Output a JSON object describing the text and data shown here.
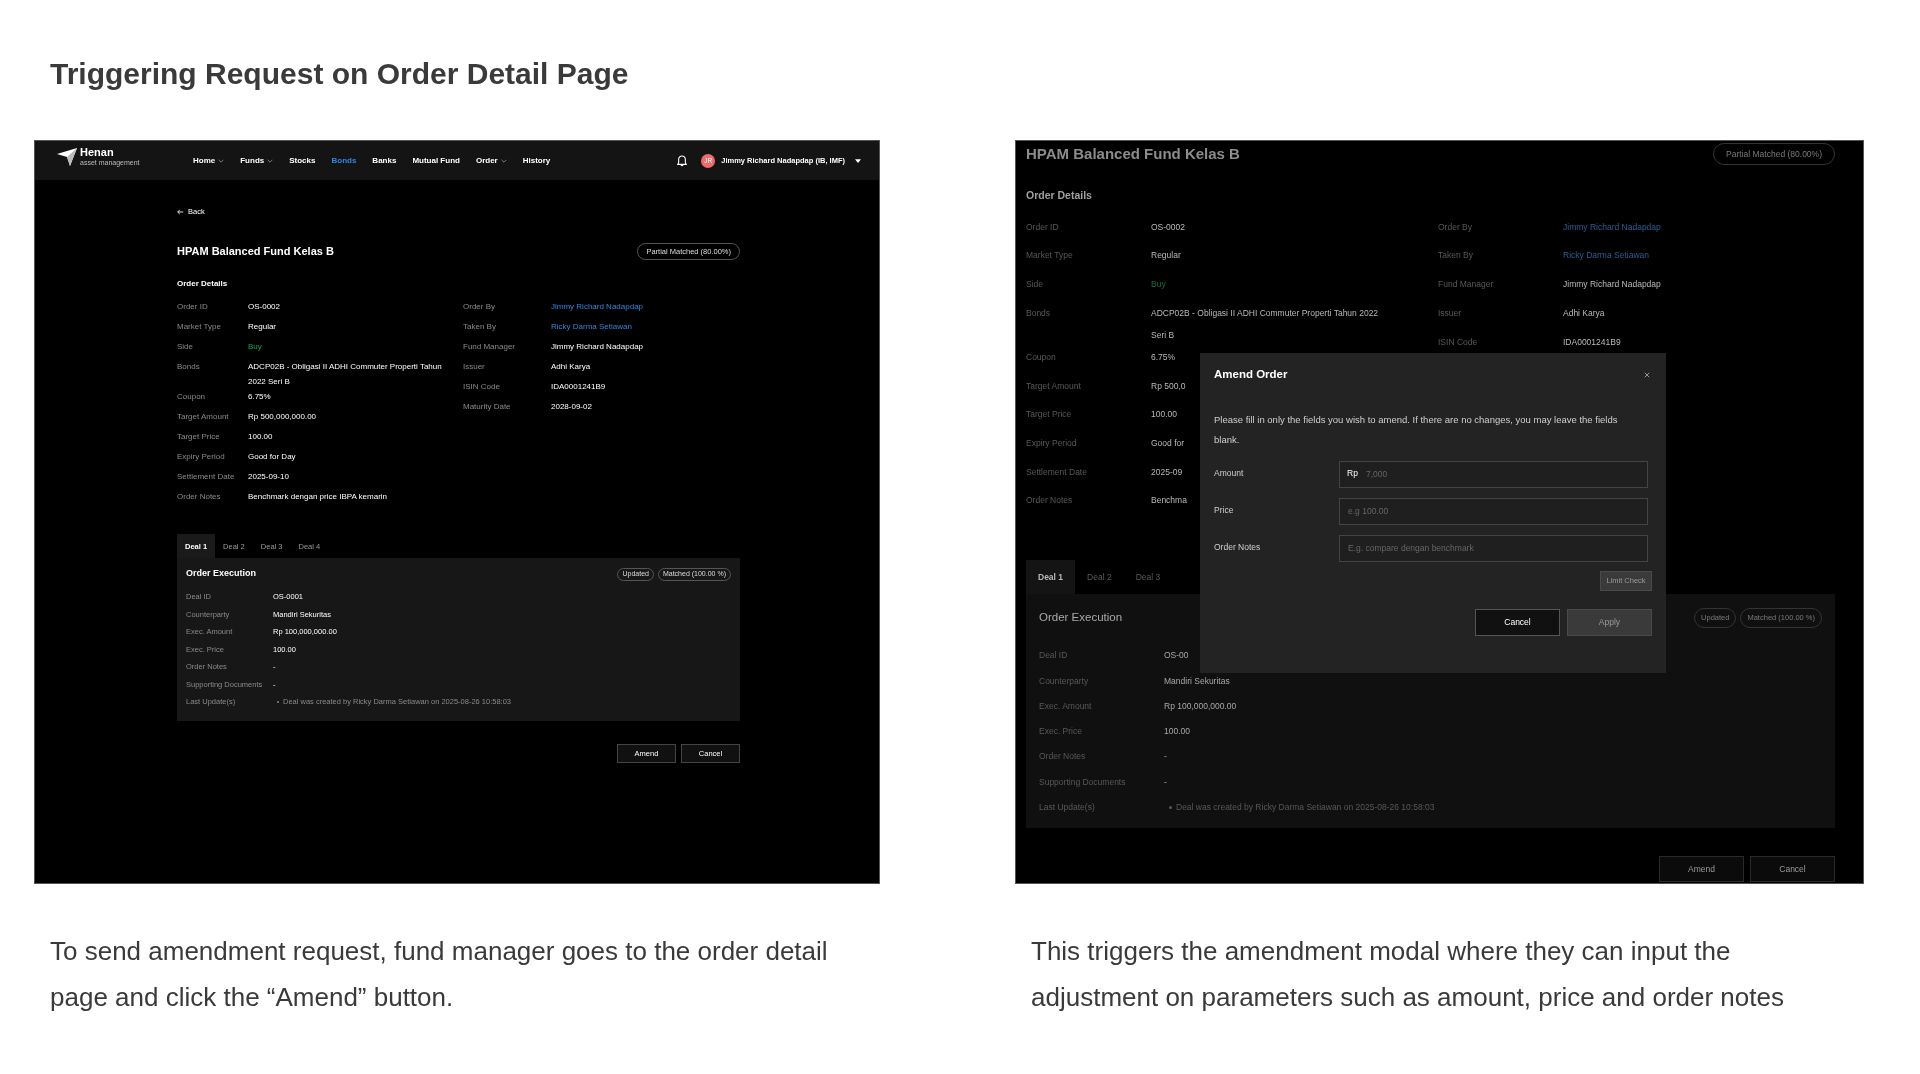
{
  "heading": "Triggering Request on Order Detail Page",
  "detail_screen": {
    "nav": {
      "logo": {
        "name": "Henan",
        "tagline": "asset management"
      },
      "items": [
        {
          "label": "Home",
          "menu": true,
          "selected": false
        },
        {
          "label": "Funds",
          "menu": true,
          "selected": false
        },
        {
          "label": "Stocks",
          "menu": false,
          "selected": false
        },
        {
          "label": "Bonds",
          "menu": false,
          "selected": true
        },
        {
          "label": "Banks",
          "menu": false,
          "selected": false
        },
        {
          "label": "Mutual Fund",
          "menu": false,
          "selected": false
        },
        {
          "label": "Order",
          "menu": true,
          "selected": false
        },
        {
          "label": "History",
          "menu": false,
          "selected": false
        }
      ],
      "user": {
        "initials": "JR",
        "name": "Jimmy Richard Nadapdap (IB, IMF)"
      }
    },
    "back": "Back",
    "title": "HPAM Balanced Fund Kelas B",
    "status": "Partial Matched (80.00%)",
    "section": "Order Details",
    "left_fields": [
      {
        "label": "Order ID",
        "value": "OS-0002",
        "kind": "text"
      },
      {
        "label": "Market Type",
        "value": "Regular",
        "kind": "text"
      },
      {
        "label": "Side",
        "value": "Buy",
        "kind": "positive"
      },
      {
        "label": "Bonds",
        "value": "ADCP02B - Obligasi II ADHI Commuter Properti Tahun 2022 Seri B",
        "kind": "text"
      },
      {
        "label": "Coupon",
        "value": "6.75%",
        "kind": "text"
      },
      {
        "label": "Target Amount",
        "value": "Rp 500,000,000.00",
        "kind": "text"
      },
      {
        "label": "Target Price",
        "value": "100.00",
        "kind": "text"
      },
      {
        "label": "Expiry Period",
        "value": "Good for Day",
        "kind": "text"
      },
      {
        "label": "Settlement Date",
        "value": "2025-09-10",
        "kind": "text"
      },
      {
        "label": "Order Notes",
        "value": "Benchmark dengan price IBPA kemarin",
        "kind": "text"
      }
    ],
    "right_fields": [
      {
        "label": "Order By",
        "value": "Jimmy Richard Nadapdap",
        "kind": "link"
      },
      {
        "label": "Taken By",
        "value": "Ricky Darma Setiawan",
        "kind": "link"
      },
      {
        "label": "Fund Manager",
        "value": "Jimmy Richard Nadapdap",
        "kind": "text"
      },
      {
        "label": "Issuer",
        "value": "Adhi Karya",
        "kind": "text"
      },
      {
        "label": "ISIN Code",
        "value": "IDA0001241B9",
        "kind": "text"
      },
      {
        "label": "Maturity Date",
        "value": "2028-09-02",
        "kind": "text"
      }
    ],
    "tabs": [
      {
        "label": "Deal 1",
        "selected": true
      },
      {
        "label": "Deal 2",
        "selected": false
      },
      {
        "label": "Deal 3",
        "selected": false
      },
      {
        "label": "Deal 4",
        "selected": false
      }
    ],
    "execution": {
      "title": "Order Execution",
      "badges": [
        "Updated",
        "Matched (100.00 %)"
      ],
      "fields": [
        {
          "label": "Deal ID",
          "value": "OS-0001"
        },
        {
          "label": "Counterparty",
          "value": "Mandiri Sekuritas"
        },
        {
          "label": "Exec. Amount",
          "value": "Rp 100,000,000.00"
        },
        {
          "label": "Exec. Price",
          "value": "100.00"
        },
        {
          "label": "Order Notes",
          "value": "-"
        },
        {
          "label": "Supporting Documents",
          "value": "-"
        }
      ],
      "updates_label": "Last Update(s)",
      "updates": [
        "Deal was created by Ricky Darma Setiawan on 2025-08-26 10:58:03"
      ]
    },
    "buttons": [
      "Amend",
      "Cancel"
    ]
  },
  "modal_screen": {
    "title": "HPAM Balanced Fund Kelas B",
    "status": "Partial Matched (80.00%)",
    "section": "Order Details",
    "left_fields": [
      {
        "label": "Order ID",
        "value": "OS-0002",
        "kind": "text"
      },
      {
        "label": "Market Type",
        "value": "Regular",
        "kind": "text"
      },
      {
        "label": "Side",
        "value": "Buy",
        "kind": "positive"
      },
      {
        "label": "Bonds",
        "value": "ADCP02B - Obligasi II ADHI Commuter Properti Tahun 2022 Seri B",
        "kind": "text"
      },
      {
        "label": "Coupon",
        "value": "6.75%",
        "kind": "text"
      },
      {
        "label": "Target Amount",
        "value": "Rp 500,0",
        "kind": "text"
      },
      {
        "label": "Target Price",
        "value": "100.00",
        "kind": "text"
      },
      {
        "label": "Expiry Period",
        "value": "Good for",
        "kind": "text"
      },
      {
        "label": "Settlement Date",
        "value": "2025-09",
        "kind": "text"
      },
      {
        "label": "Order Notes",
        "value": "Benchma",
        "kind": "text"
      }
    ],
    "right_fields": [
      {
        "label": "Order By",
        "value": "Jimmy Richard Nadapdap",
        "kind": "link"
      },
      {
        "label": "Taken By",
        "value": "Ricky Darma Setiawan",
        "kind": "link"
      },
      {
        "label": "Fund Manager",
        "value": "Jimmy Richard Nadapdap",
        "kind": "text"
      },
      {
        "label": "Issuer",
        "value": "Adhi Karya",
        "kind": "text"
      },
      {
        "label": "ISIN Code",
        "value": "IDA0001241B9",
        "kind": "text"
      }
    ],
    "tabs": [
      {
        "label": "Deal 1",
        "selected": true
      },
      {
        "label": "Deal 2",
        "selected": false
      },
      {
        "label": "Deal 3",
        "selected": false
      }
    ],
    "execution": {
      "title": "Order Execution",
      "badges": [
        "Updated",
        "Matched (100.00 %)"
      ],
      "fields": [
        {
          "label": "Deal ID",
          "value": "OS-00"
        },
        {
          "label": "Counterparty",
          "value": "Mandiri Sekuritas"
        },
        {
          "label": "Exec. Amount",
          "value": "Rp 100,000,000.00"
        },
        {
          "label": "Exec. Price",
          "value": "100.00"
        },
        {
          "label": "Order Notes",
          "value": "-"
        },
        {
          "label": "Supporting Documents",
          "value": "-"
        }
      ],
      "updates_label": "Last Update(s)",
      "updates": [
        "Deal was created by Ricky Darma Setiawan on 2025-08-26 10:58:03"
      ]
    },
    "buttons": [
      "Amend",
      "Cancel"
    ],
    "modal": {
      "title": "Amend Order",
      "description": "Please fill in only the fields you wish to amend. If there are no changes, you may leave the fields blank.",
      "fields": [
        {
          "label": "Amount",
          "prefix": "Rp",
          "placeholder": "7,000"
        },
        {
          "label": "Price",
          "placeholder": "e.g 100.00"
        },
        {
          "label": "Order Notes",
          "placeholder": "E.g. compare dengan benchmark"
        }
      ],
      "check_button": {
        "label": "Limit Check",
        "disabled": true
      },
      "buttons": [
        {
          "label": "Cancel",
          "disabled": false
        },
        {
          "label": "Apply",
          "disabled": true
        }
      ]
    }
  },
  "captions": [
    "To send amendment request, fund manager goes to the order detail page and click the “Amend” button.",
    "This triggers the amendment modal where they can input the adjustment on parameters such as amount, price and order notes"
  ]
}
